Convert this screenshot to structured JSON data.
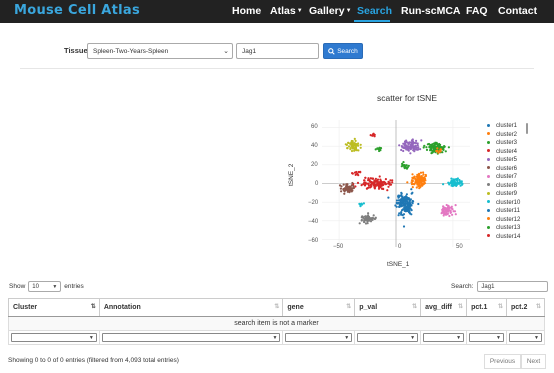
{
  "navbar": {
    "brand": "Mouse Cell Atlas",
    "items": [
      {
        "label": "Home"
      },
      {
        "label": "Atlas"
      },
      {
        "label": "Gallery"
      },
      {
        "label": "Search"
      },
      {
        "label": "Run-scMCA"
      },
      {
        "label": "FAQ"
      },
      {
        "label": "Contact"
      }
    ],
    "active": "Search",
    "accent_color": "#29a3e0"
  },
  "search": {
    "tissue_label": "Tissue",
    "tissue_value": "Spleen-Two-Years-Spleen",
    "gene_value": "Jag1",
    "button_label": "Search",
    "button_icon": "search-icon",
    "button_color": "#2f7ad0"
  },
  "chart_data": {
    "type": "scatter",
    "title": "scatter for tSNE",
    "xlabel": "tSNE_1",
    "ylabel": "tSNE_2",
    "xticks": [
      "−50",
      "0",
      "50"
    ],
    "yticks": [
      "60",
      "40",
      "20",
      "0",
      "−20",
      "−40",
      "−60"
    ],
    "xlim": [
      -65,
      65
    ],
    "ylim": [
      -68,
      68
    ],
    "legend_position": "right",
    "series": [
      {
        "name": "cluster1",
        "color": "#1f77b4"
      },
      {
        "name": "cluster2",
        "color": "#ff7f0e"
      },
      {
        "name": "cluster3",
        "color": "#2ca02c"
      },
      {
        "name": "cluster4",
        "color": "#d62728"
      },
      {
        "name": "cluster5",
        "color": "#9467bd"
      },
      {
        "name": "cluster6",
        "color": "#8c564b"
      },
      {
        "name": "cluster7",
        "color": "#e377c2"
      },
      {
        "name": "cluster8",
        "color": "#7f7f7f"
      },
      {
        "name": "cluster9",
        "color": "#bcbd22"
      },
      {
        "name": "cluster10",
        "color": "#17becf"
      },
      {
        "name": "cluster11",
        "color": "#1f77b4"
      },
      {
        "name": "cluster12",
        "color": "#ff7f0e"
      },
      {
        "name": "cluster13",
        "color": "#2ca02c"
      },
      {
        "name": "cluster14",
        "color": "#d62728"
      }
    ],
    "clusters": [
      {
        "series": 0,
        "cx": 8,
        "cy": -22,
        "sx": 7,
        "sy": 11,
        "n": 170
      },
      {
        "series": 1,
        "cx": 20,
        "cy": 3,
        "sx": 7,
        "sy": 7,
        "n": 110
      },
      {
        "series": 2,
        "cx": 35,
        "cy": 38,
        "sx": 8,
        "sy": 5,
        "n": 110
      },
      {
        "series": 3,
        "cx": -18,
        "cy": 0,
        "sx": 12,
        "sy": 6,
        "n": 120
      },
      {
        "series": 4,
        "cx": 12,
        "cy": 40,
        "sx": 8,
        "sy": 6,
        "n": 90
      },
      {
        "series": 5,
        "cx": -42,
        "cy": -5,
        "sx": 5,
        "sy": 6,
        "n": 60
      },
      {
        "series": 6,
        "cx": 45,
        "cy": -28,
        "sx": 6,
        "sy": 5,
        "n": 60
      },
      {
        "series": 7,
        "cx": -25,
        "cy": -38,
        "sx": 6,
        "sy": 5,
        "n": 60
      },
      {
        "series": 8,
        "cx": -38,
        "cy": 40,
        "sx": 5,
        "sy": 6,
        "n": 60
      },
      {
        "series": 9,
        "cx": 52,
        "cy": 1,
        "sx": 7,
        "sy": 4,
        "n": 60
      },
      {
        "series": 12,
        "cx": 8,
        "cy": 18,
        "sx": 3,
        "sy": 3,
        "n": 18
      },
      {
        "series": 13,
        "cx": -35,
        "cy": 11,
        "sx": 3,
        "sy": 2,
        "n": 12
      },
      {
        "series": 3,
        "cx": -20,
        "cy": 52,
        "sx": 2,
        "sy": 2,
        "n": 10
      },
      {
        "series": 2,
        "cx": -15,
        "cy": 37,
        "sx": 3,
        "sy": 2,
        "n": 14
      },
      {
        "series": 1,
        "cx": 38,
        "cy": 35,
        "sx": 3,
        "sy": 2,
        "n": 10
      },
      {
        "series": 9,
        "cx": -30,
        "cy": -22,
        "sx": 2,
        "sy": 2,
        "n": 8
      }
    ]
  },
  "table": {
    "length_prefix": "Show",
    "length_value": "10",
    "length_suffix": "entries",
    "search_label": "Search:",
    "search_value": "Jag1",
    "columns": [
      "Cluster",
      "Annotation",
      "gene",
      "p_val",
      "avg_diff",
      "pct.1",
      "pct.2"
    ],
    "empty_message": "search item is not a marker",
    "info": "Showing 0 to 0 of 0 entries (filtered from 4,093 total entries)",
    "previous_label": "Previous",
    "next_label": "Next"
  }
}
